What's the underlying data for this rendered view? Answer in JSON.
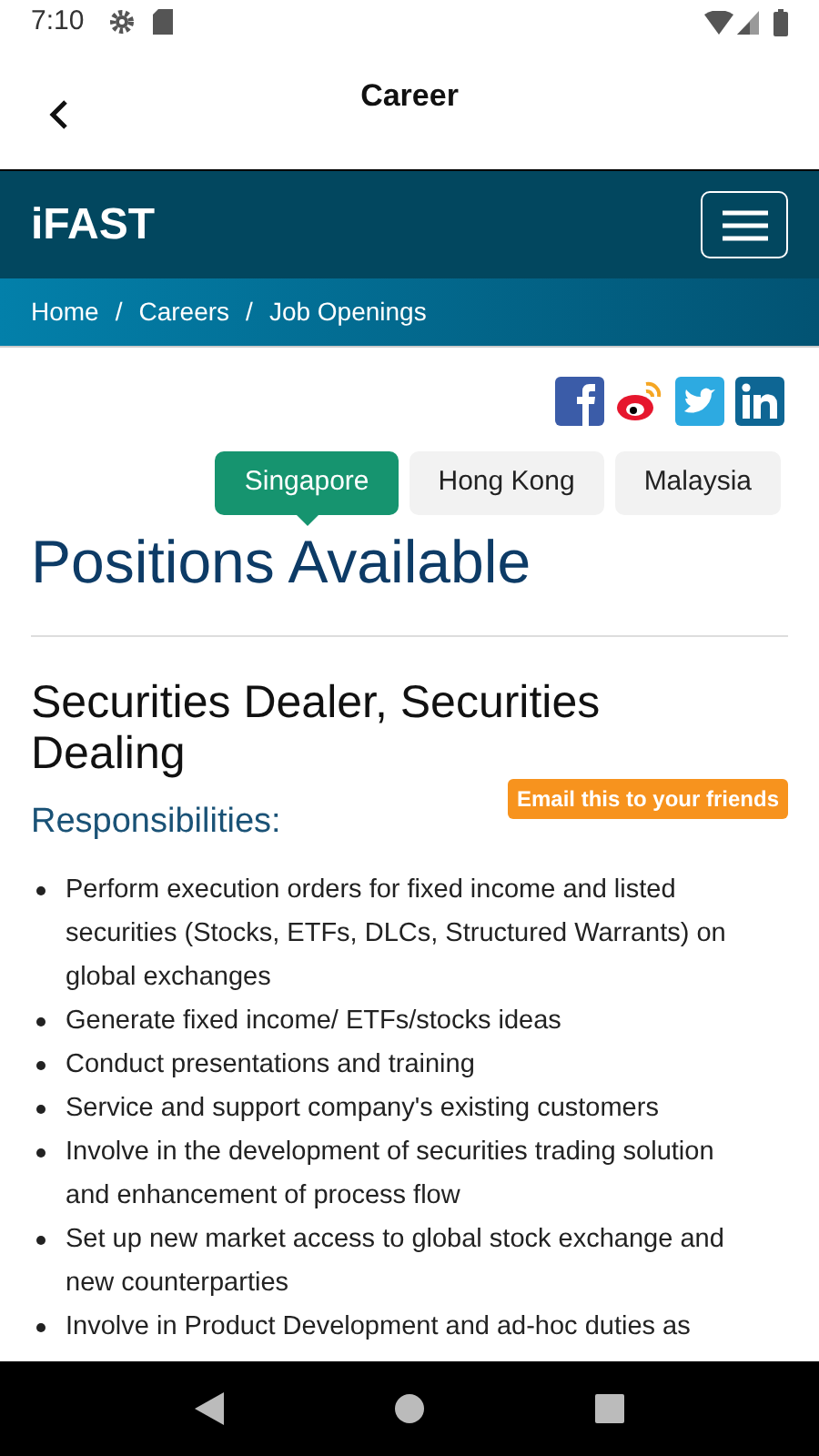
{
  "status_bar": {
    "time": "7:10"
  },
  "app_bar": {
    "title": "Career"
  },
  "site_header": {
    "logo": "iFAST"
  },
  "breadcrumb": [
    "Home",
    "Careers",
    "Job Openings"
  ],
  "breadcrumb_separator": "/",
  "location_tabs": [
    {
      "label": "Singapore",
      "selected": true
    },
    {
      "label": "Hong Kong",
      "selected": false
    },
    {
      "label": "Malaysia",
      "selected": false
    }
  ],
  "heading": "Positions Available",
  "job": {
    "title": "Securities Dealer, Securities Dealing",
    "email_button": "Email this to your friends",
    "section": "Responsibilities:",
    "items": [
      "Perform execution orders for fixed income and listed securities (Stocks, ETFs, DLCs, Structured Warrants) on global exchanges",
      "Generate fixed income/ ETFs/stocks ideas",
      "Conduct presentations and training",
      "Service and support company's existing customers",
      "Involve in the development of securities trading solution and enhancement of process flow",
      "Set up new market access to global stock exchange and new counterparties",
      "Involve in Product Development and ad-hoc duties as"
    ]
  }
}
